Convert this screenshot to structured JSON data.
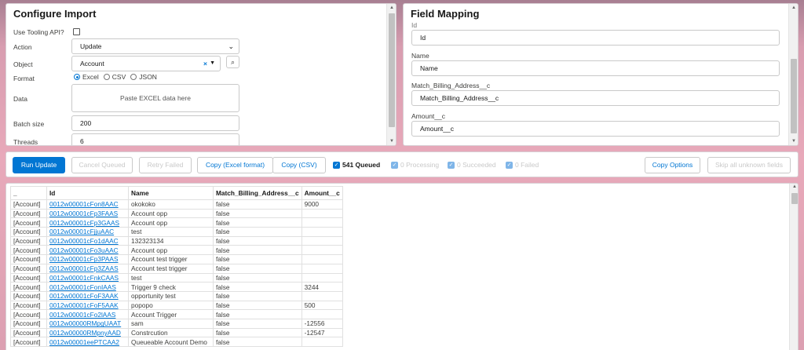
{
  "config": {
    "title": "Configure Import",
    "tooling_label": "Use Tooling API?",
    "action_label": "Action",
    "action_value": "Update",
    "object_label": "Object",
    "object_value": "Account",
    "format_label": "Format",
    "format_options": [
      "Excel",
      "CSV",
      "JSON"
    ],
    "format_selected": "Excel",
    "data_label": "Data",
    "data_placeholder": "Paste EXCEL data here",
    "batch_label": "Batch size",
    "batch_value": "200",
    "threads_label": "Threads",
    "threads_value": "6"
  },
  "mapping": {
    "title": "Field Mapping",
    "cut_label": "Id",
    "fields": [
      {
        "label": "Id",
        "value": "Id"
      },
      {
        "label": "Name",
        "value": "Name"
      },
      {
        "label": "Match_Billing_Address__c",
        "value": "Match_Billing_Address__c"
      },
      {
        "label": "Amount__c",
        "value": "Amount__c"
      }
    ]
  },
  "toolbar": {
    "run_update": "Run Update",
    "cancel_queued": "Cancel Queued",
    "retry_failed": "Retry Failed",
    "copy_excel": "Copy (Excel format)",
    "copy_csv": "Copy (CSV)",
    "queued": "541 Queued",
    "processing": "0 Processing",
    "succeeded": "0 Succeeded",
    "failed": "0 Failed",
    "copy_options": "Copy Options",
    "skip_unknown": "Skip all unknown fields"
  },
  "table": {
    "headers": [
      "_",
      "Id",
      "Name",
      "Match_Billing_Address__c",
      "Amount__c"
    ],
    "rows": [
      [
        "[Account]",
        "0012w00001cFon8AAC",
        "okokoko",
        "false",
        "9000"
      ],
      [
        "[Account]",
        "0012w00001cFp3FAAS",
        "Account opp",
        "false",
        ""
      ],
      [
        "[Account]",
        "0012w00001cFp3GAAS",
        "Account opp",
        "false",
        ""
      ],
      [
        "[Account]",
        "0012w00001cFjjuAAC",
        "test",
        "false",
        ""
      ],
      [
        "[Account]",
        "0012w00001cFo1dAAC",
        "132323134",
        "false",
        ""
      ],
      [
        "[Account]",
        "0012w00001cFo3uAAC",
        "Account opp",
        "false",
        ""
      ],
      [
        "[Account]",
        "0012w00001cFp3PAAS",
        "Account test trigger",
        "false",
        ""
      ],
      [
        "[Account]",
        "0012w00001cFp3ZAAS",
        "Account test trigger",
        "false",
        ""
      ],
      [
        "[Account]",
        "0012w00001cFnkCAAS",
        "test",
        "false",
        ""
      ],
      [
        "[Account]",
        "0012w00001cFonIAAS",
        "Trigger 9 check",
        "false",
        "3244"
      ],
      [
        "[Account]",
        "0012w00001cFoF3AAK",
        "opportunity test",
        "false",
        ""
      ],
      [
        "[Account]",
        "0012w00001cFoF5AAK",
        "popopo",
        "false",
        "500"
      ],
      [
        "[Account]",
        "0012w00001cFo2lAAS",
        "Account Trigger",
        "false",
        ""
      ],
      [
        "[Account]",
        "0012w00000RMpgUAAT",
        "sam",
        "false",
        "-12556"
      ],
      [
        "[Account]",
        "0012w00000RMpnyAAD",
        "Constrcution",
        "false",
        "-12547"
      ],
      [
        "[Account]",
        "0012w00001eePTCAA2",
        "Queueable Account Demo",
        "false",
        ""
      ]
    ]
  },
  "colors": {
    "accent": "#0176d3",
    "background": "#e8a9ba"
  }
}
